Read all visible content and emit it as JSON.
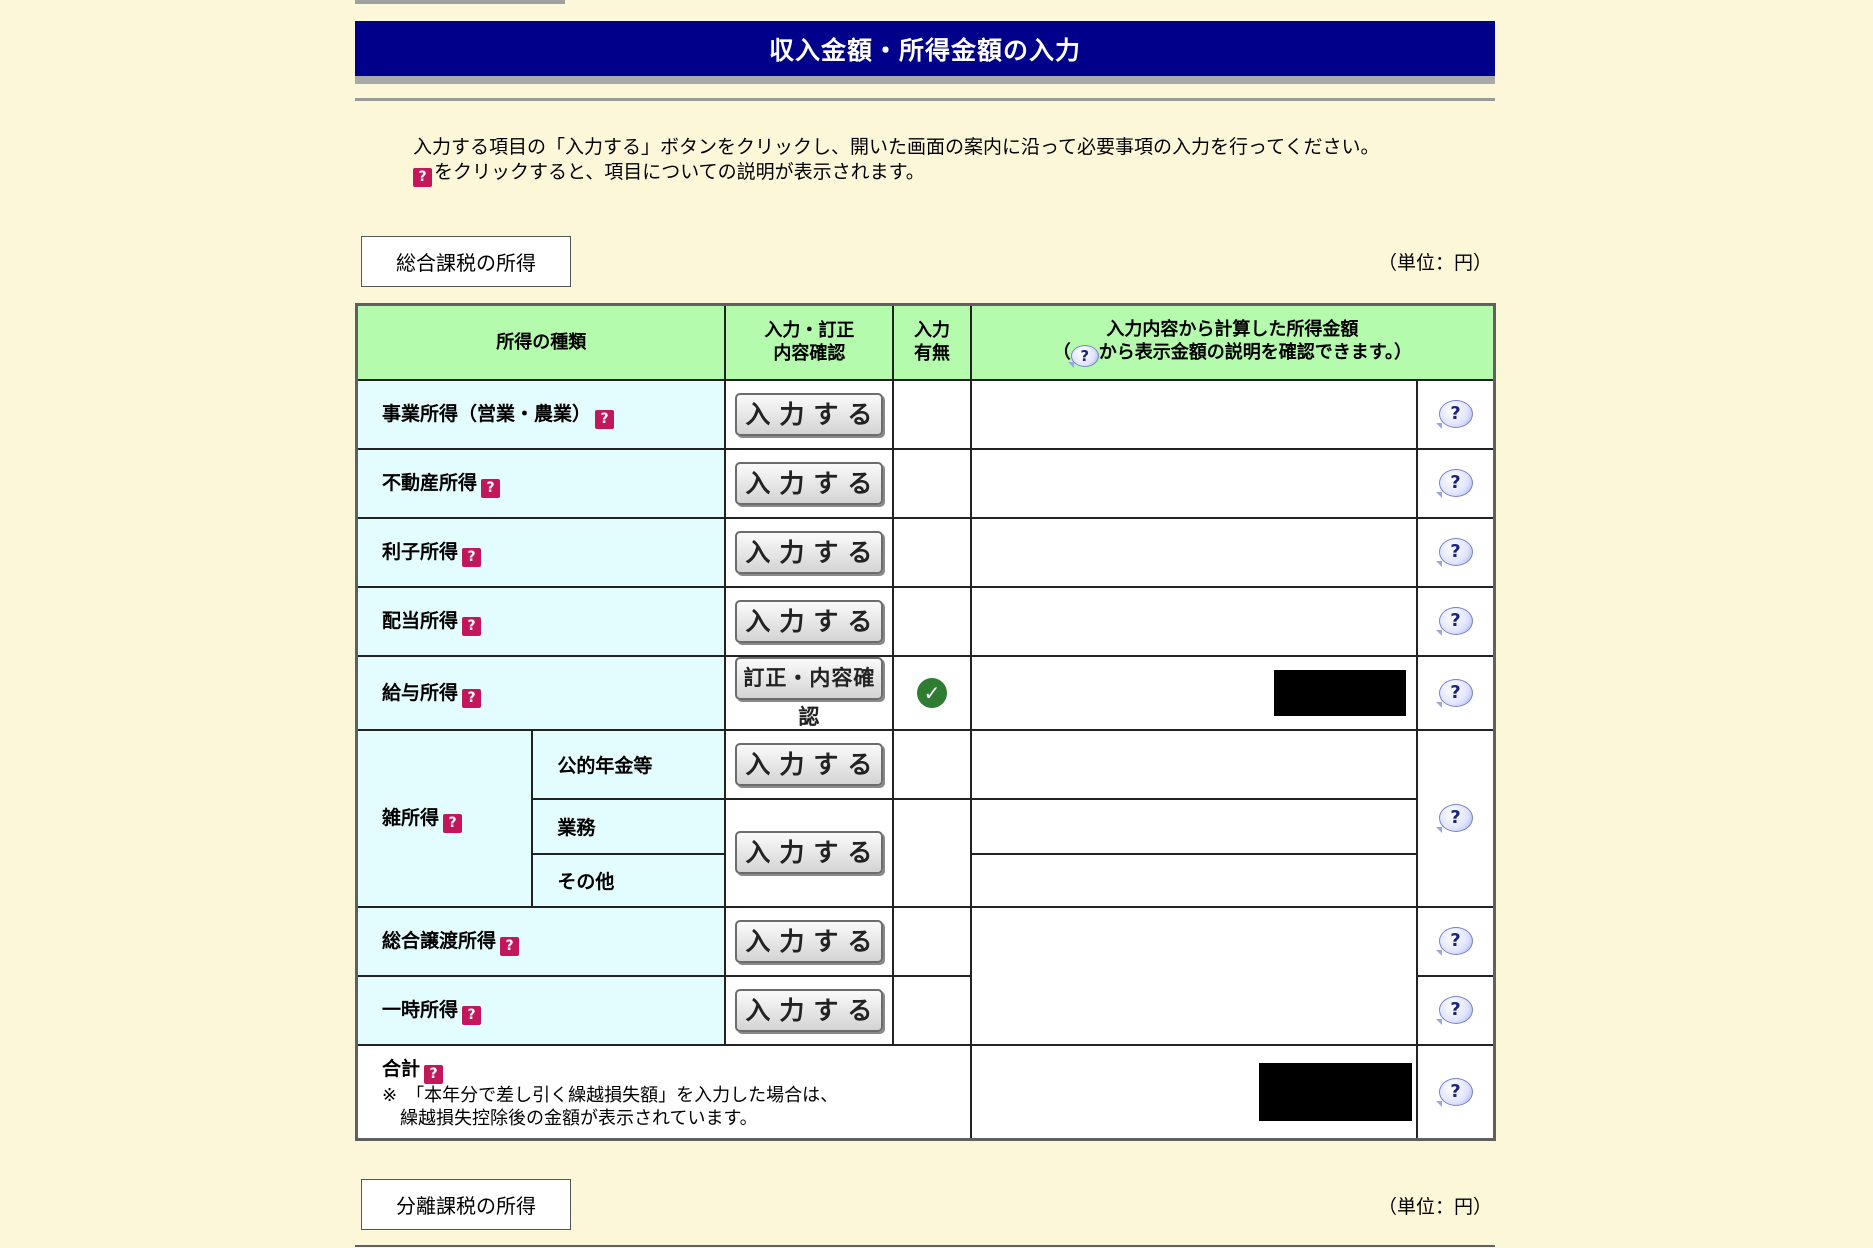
{
  "page": {
    "title": "収入金額・所得金額の入力",
    "intro_line1": "入力する項目の「入力する」ボタンをクリックし、開いた画面の案内に沿って必要事項の入力を行ってください。",
    "intro_line2": "をクリックすると、項目についての説明が表示されます。"
  },
  "sections": {
    "sogo_label": "総合課税の所得",
    "bunri_label": "分離課税の所得",
    "unit": "（単位：円）"
  },
  "table": {
    "headers": {
      "kind": "所得の種類",
      "action_line1": "入力・訂正",
      "action_line2": "内容確認",
      "status_line1": "入力",
      "status_line2": "有無",
      "amount_line1": "入力内容から計算した所得金額",
      "amount_line2_pre": "（",
      "amount_line2_post": "から表示金額の説明を確認できます。）"
    },
    "rows": {
      "jigyo": "事業所得（営業・農業）",
      "fudosan": "不動産所得",
      "rishi": "利子所得",
      "haito": "配当所得",
      "kyuyo": "給与所得",
      "zatsu": "雑所得",
      "zatsu_nenkin": "公的年金等",
      "zatsu_gyomu": "業務",
      "zatsu_sonota": "その他",
      "jyoto": "総合譲渡所得",
      "ichiji": "一時所得",
      "total": "合計",
      "total_note1": "※　「本年分で差し引く繰越損失額」を入力した場合は、",
      "total_note2": "　繰越損失控除後の金額が表示されています。"
    },
    "buttons": {
      "input": "入力する",
      "correct": "訂正・内容確認"
    }
  },
  "icons": {
    "help_square": "question-square-icon",
    "help_bubble": "question-bubble-icon",
    "check": "check-circle-icon"
  },
  "colors": {
    "title_bg": "#00008b",
    "header_bg": "#b5fbae",
    "kind_bg": "#e3fcfe",
    "page_bg": "#fdf7da"
  }
}
